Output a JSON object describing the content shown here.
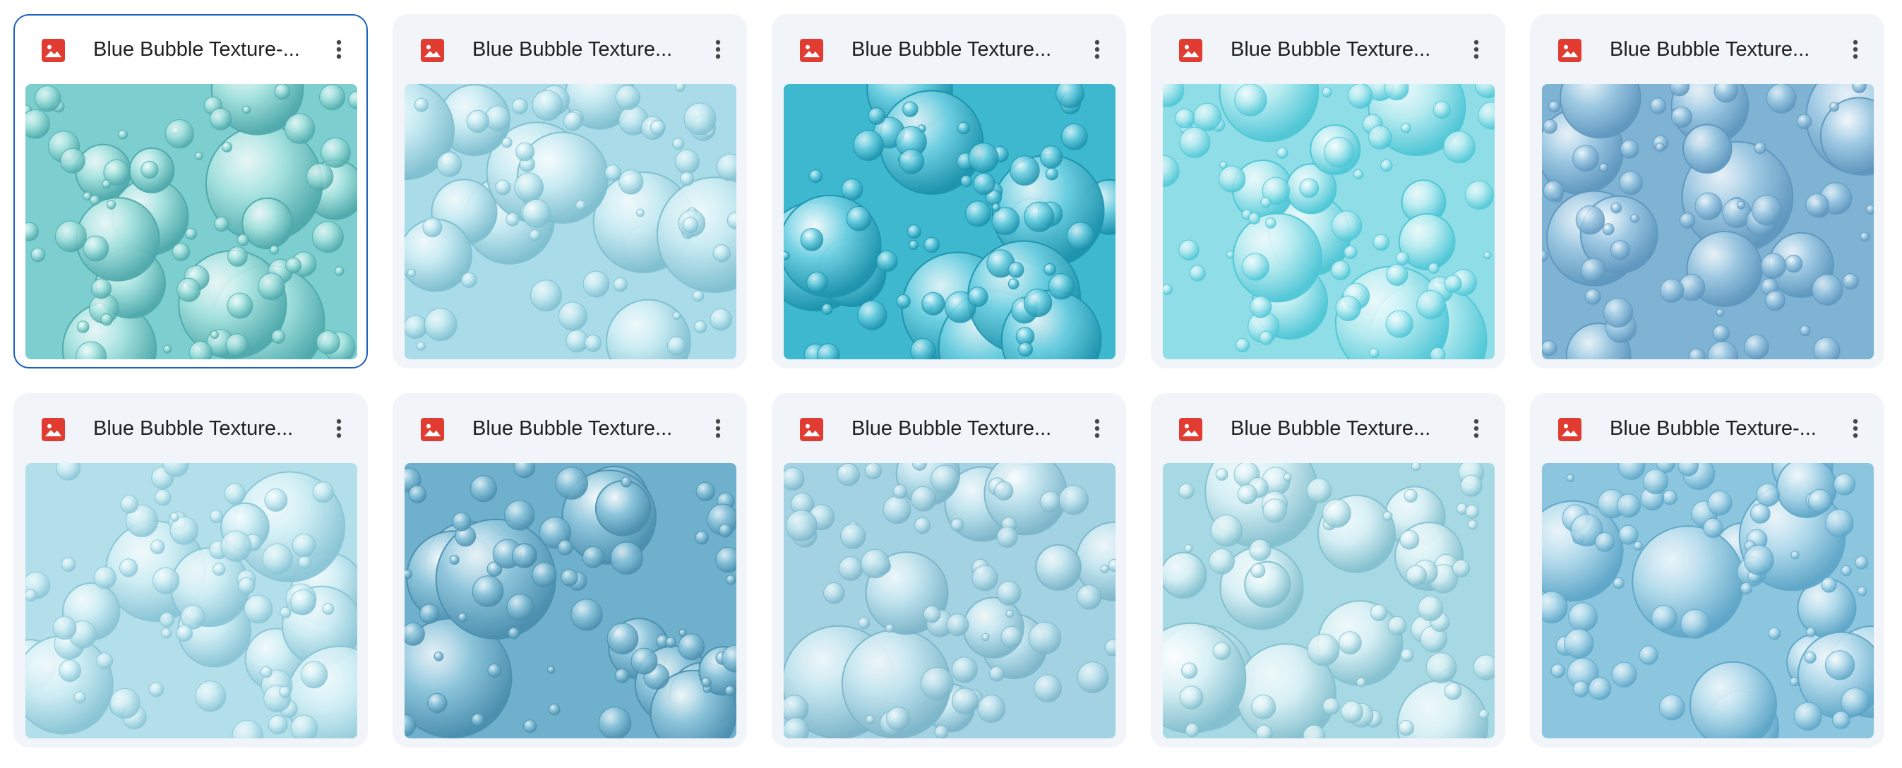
{
  "files": [
    {
      "title": "Blue Bubble Texture-...",
      "selected": true,
      "palette": {
        "bg": "#7dcfcf",
        "bubble": "#a7e3df",
        "edge": "#4fa9ab"
      }
    },
    {
      "title": "Blue Bubble Texture...",
      "selected": false,
      "palette": {
        "bg": "#a9dce8",
        "bubble": "#c8ebf2",
        "edge": "#7fbfd0"
      }
    },
    {
      "title": "Blue Bubble Texture...",
      "selected": false,
      "palette": {
        "bg": "#3db8cf",
        "bubble": "#6fd0e2",
        "edge": "#1d93ad"
      }
    },
    {
      "title": "Blue Bubble Texture...",
      "selected": false,
      "palette": {
        "bg": "#8fdde6",
        "bubble": "#b9ecf1",
        "edge": "#4ec6d6"
      }
    },
    {
      "title": "Blue Bubble Texture...",
      "selected": false,
      "palette": {
        "bg": "#7eb3d3",
        "bubble": "#9fcae3",
        "edge": "#5f97bf"
      }
    },
    {
      "title": "Blue Bubble Texture...",
      "selected": false,
      "palette": {
        "bg": "#b2dfe9",
        "bubble": "#cfeef4",
        "edge": "#8ac5d6"
      }
    },
    {
      "title": "Blue Bubble Texture...",
      "selected": false,
      "palette": {
        "bg": "#6fb1cc",
        "bubble": "#8ec6dc",
        "edge": "#4b8fae"
      }
    },
    {
      "title": "Blue Bubble Texture...",
      "selected": false,
      "palette": {
        "bg": "#a3d3e2",
        "bubble": "#c1e4ee",
        "edge": "#7db6ca"
      }
    },
    {
      "title": "Blue Bubble Texture...",
      "selected": false,
      "palette": {
        "bg": "#a6d9e3",
        "bubble": "#d9f1f5",
        "edge": "#84c0cf"
      }
    },
    {
      "title": "Blue Bubble Texture-...",
      "selected": false,
      "palette": {
        "bg": "#8cc6de",
        "bubble": "#b5dcec",
        "edge": "#5ea6c8"
      }
    }
  ],
  "file_type_icon": "image-file-icon",
  "menu_icon": "more-vert-icon",
  "colors": {
    "icon_red": "#e03c32",
    "selected_border": "#1a5fbf",
    "card_bg": "#f1f4f9"
  }
}
